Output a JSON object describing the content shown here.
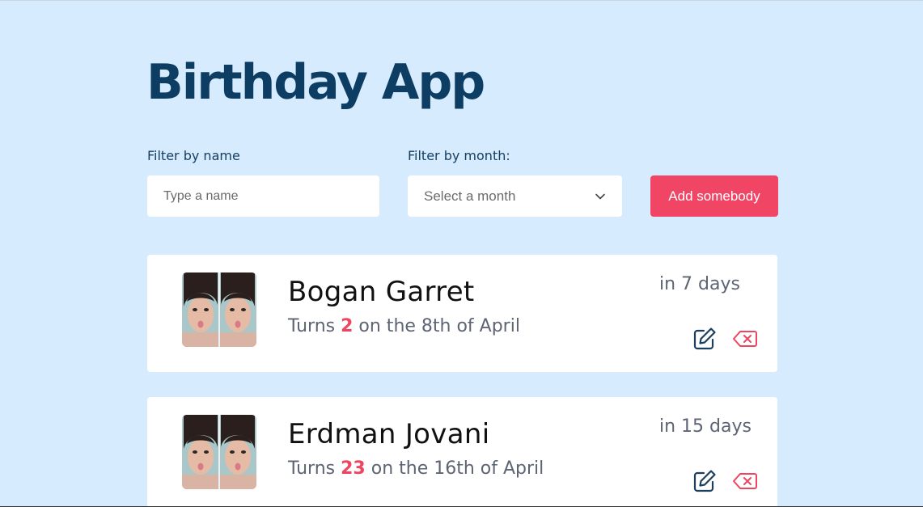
{
  "app": {
    "title": "Birthday App"
  },
  "filters": {
    "name_label": "Filter by name",
    "name_placeholder": "Type a name",
    "month_label": "Filter by month:",
    "month_selected": "Select a month",
    "add_button": "Add somebody"
  },
  "icons": {
    "chevron": "chevron-down-icon",
    "edit": "edit-icon",
    "delete": "delete-icon"
  },
  "colors": {
    "background": "#d6ebfd",
    "title": "#0d3d63",
    "accent": "#f04565",
    "edit_icon": "#1d3f5e",
    "delete_icon": "#ee4660"
  },
  "people": [
    {
      "name": "Bogan Garret",
      "turns_prefix": "Turns ",
      "age": "2",
      "turns_suffix": " on the 8th of April",
      "countdown": "in 7 days"
    },
    {
      "name": "Erdman Jovani",
      "turns_prefix": "Turns ",
      "age": "23",
      "turns_suffix": " on the 16th of April",
      "countdown": "in 15 days"
    }
  ]
}
